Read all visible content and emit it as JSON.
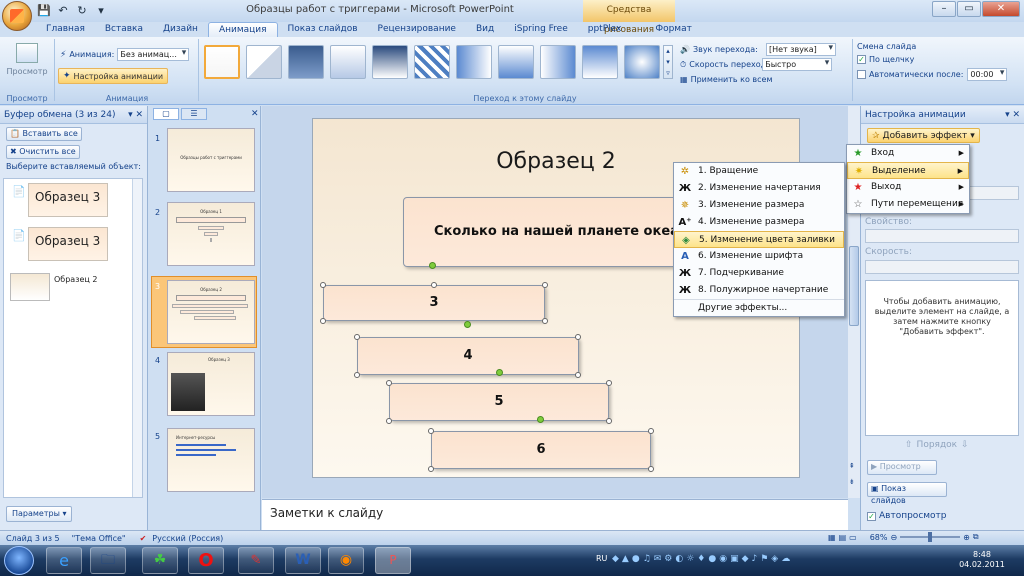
{
  "window": {
    "title": "Образцы работ с триггерами - Microsoft PowerPoint",
    "context_tab_group": "Средства рисования",
    "buttons": {
      "minimize": "–",
      "maximize": "▭",
      "close": "✕"
    }
  },
  "tabs": [
    {
      "label": "Главная"
    },
    {
      "label": "Вставка"
    },
    {
      "label": "Дизайн"
    },
    {
      "label": "Анимация",
      "active": true
    },
    {
      "label": "Показ слайдов"
    },
    {
      "label": "Рецензирование"
    },
    {
      "label": "Вид"
    },
    {
      "label": "iSpring Free"
    },
    {
      "label": "pptPlex"
    },
    {
      "label": "Формат"
    }
  ],
  "ribbon": {
    "preview": {
      "button": "Просмотр",
      "group": "Просмотр"
    },
    "animation": {
      "label": "Анимация:",
      "value": "Без анимац...",
      "custom_button": "Настройка анимации",
      "group": "Анимация"
    },
    "transition": {
      "sound_label": "Звук перехода:",
      "sound_value": "[Нет звука]",
      "speed_label": "Скорость перехода:",
      "speed_value": "Быстро",
      "apply_all": "Применить ко всем",
      "group": "Переход к этому слайду"
    },
    "advance": {
      "title": "Смена слайда",
      "on_click": "По щелчку",
      "auto": "Автоматически после:",
      "auto_time": "00:00"
    }
  },
  "clipboard": {
    "title": "Буфер обмена (3 из 24)",
    "paste_all": "Вставить все",
    "clear_all": "Очистить все",
    "hint": "Выберите вставляемый объект:",
    "items": [
      {
        "text": "Образец 3"
      },
      {
        "text": "Образец 3"
      },
      {
        "text": "Образец 2"
      }
    ],
    "options_button": "Параметры"
  },
  "thumbnails": [
    {
      "num": "1",
      "title": "Образцы работ с триггерами"
    },
    {
      "num": "2",
      "title": "Образец 1"
    },
    {
      "num": "3",
      "title": "Образец 2"
    },
    {
      "num": "4",
      "title": "Образец 3"
    },
    {
      "num": "5",
      "title": "Интернет-ресурсы"
    }
  ],
  "slide": {
    "title": "Образец 2",
    "question": "Сколько на нашей планете океанов?",
    "answers": [
      "3",
      "4",
      "5",
      "6"
    ]
  },
  "notes": {
    "placeholder": "Заметки к слайду"
  },
  "anim_panel": {
    "title": "Настройка анимации",
    "add_effect": "Добавить эффект",
    "property_label": "Свойство:",
    "speed_label": "Скорость:",
    "hint": "Чтобы добавить анимацию, выделите элемент на слайде, а затем нажмите кнопку \"Добавить эффект\".",
    "order_label": "Порядок",
    "preview_button": "Просмотр",
    "slideshow_button": "Показ слайдов",
    "autopreview": "Автопросмотр"
  },
  "effect_menu": [
    {
      "label": "Вход",
      "icon": "green-star-icon"
    },
    {
      "label": "Выделение",
      "icon": "yellow-star-icon",
      "highlighted": true
    },
    {
      "label": "Выход",
      "icon": "red-star-icon"
    },
    {
      "label": "Пути перемещения",
      "icon": "outline-star-icon"
    }
  ],
  "emphasis_menu": [
    {
      "label": "1. Вращение",
      "icon": "spin-icon"
    },
    {
      "label": "2. Изменение начертания",
      "icon": "bold-icon"
    },
    {
      "label": "3. Изменение размера",
      "icon": "grow-icon"
    },
    {
      "label": "4. Изменение размера шрифта",
      "icon": "font-size-icon"
    },
    {
      "label": "5. Изменение цвета заливки",
      "icon": "fill-color-icon",
      "highlighted": true
    },
    {
      "label": "6. Изменение шрифта",
      "icon": "font-icon"
    },
    {
      "label": "7. Подчеркивание",
      "icon": "underline-icon"
    },
    {
      "label": "8. Полужирное начертание",
      "icon": "bold-icon"
    },
    {
      "label": "Другие эффекты...",
      "icon": ""
    }
  ],
  "status": {
    "slide": "Слайд 3 из 5",
    "theme": "\"Тема Office\"",
    "lang": "Русский (Россия)",
    "zoom": "68%"
  },
  "taskbar": {
    "lang": "RU",
    "time": "8:48",
    "date": "04.02.2011"
  }
}
